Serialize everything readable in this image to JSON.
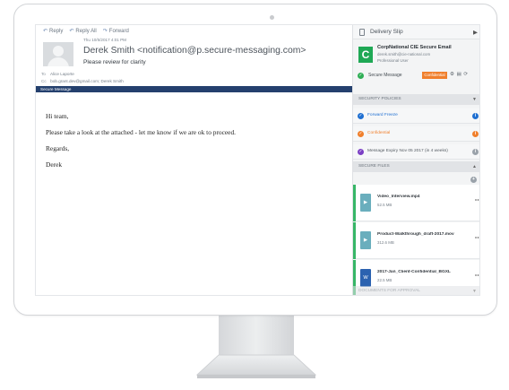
{
  "toolbar": {
    "reply_label": "Reply",
    "reply_all_label": "Reply All",
    "forward_label": "Forward"
  },
  "email": {
    "date": "Thu 10/5/2017 4:01 PM",
    "sender": "Derek Smith <notification@p.secure-messaging.com>",
    "subject": "Please review for clarity",
    "to_label": "To",
    "to_value": "Alice Laporte",
    "cc_label": "Cc",
    "cc_value": "bob.grant.dev@gmail.com; Derek Smith",
    "secure_bar": "Secure Message",
    "body": {
      "greeting": "Hi team,",
      "line1": "Please take a look at the attached - let me know if we are ok to proceed.",
      "closing": "Regards,",
      "signature": "Derek"
    }
  },
  "sidebar": {
    "title": "Delivery Slip",
    "org_logo_text": "C",
    "org_name": "CorpNational CIE Secure Email",
    "org_email": "derek.smith@cie-national.com",
    "org_role": "Professional User",
    "secure_label": "Secure Message",
    "confidential_badge": "Confidential",
    "mini_icons": "⚙ ▤ ⟳",
    "policies_header": "SECURITY POLICIES",
    "policies": [
      {
        "label": "Forward Freeze",
        "color": "#1f6fd1",
        "icon": "check-icon",
        "info_color": "#1f6fd1"
      },
      {
        "label": "Confidential",
        "color": "#f07f2c",
        "icon": "check-icon",
        "info_color": "#f07f2c"
      },
      {
        "label": "Message Expiry Nov 05 2017 (in 4 weeks)",
        "color": "#7b3fc4",
        "icon": "check-icon",
        "info_color": "#9aa2aa"
      }
    ],
    "files_header": "SECURE FILES",
    "files": [
      {
        "name": "Video_Interview.mp4",
        "size": "52.5 MB",
        "icon_color": "#6aaebd",
        "icon": "video-file-icon"
      },
      {
        "name": "Product-Walkthrough_draft-2017.mov",
        "size": "312.6 MB",
        "icon_color": "#6aaebd",
        "icon": "video-file-icon"
      },
      {
        "name": "2017-Jan_Client-Confidential_BGXL",
        "size": "22.5 MB",
        "icon_color": "#2b62b0",
        "icon": "word-file-icon"
      }
    ],
    "approval_header": "DOCUMENTS FOR APPROVAL"
  },
  "colors": {
    "secure_bar": "#24406e",
    "accent_green": "#1fa855",
    "badge_orange": "#f07f2c"
  }
}
